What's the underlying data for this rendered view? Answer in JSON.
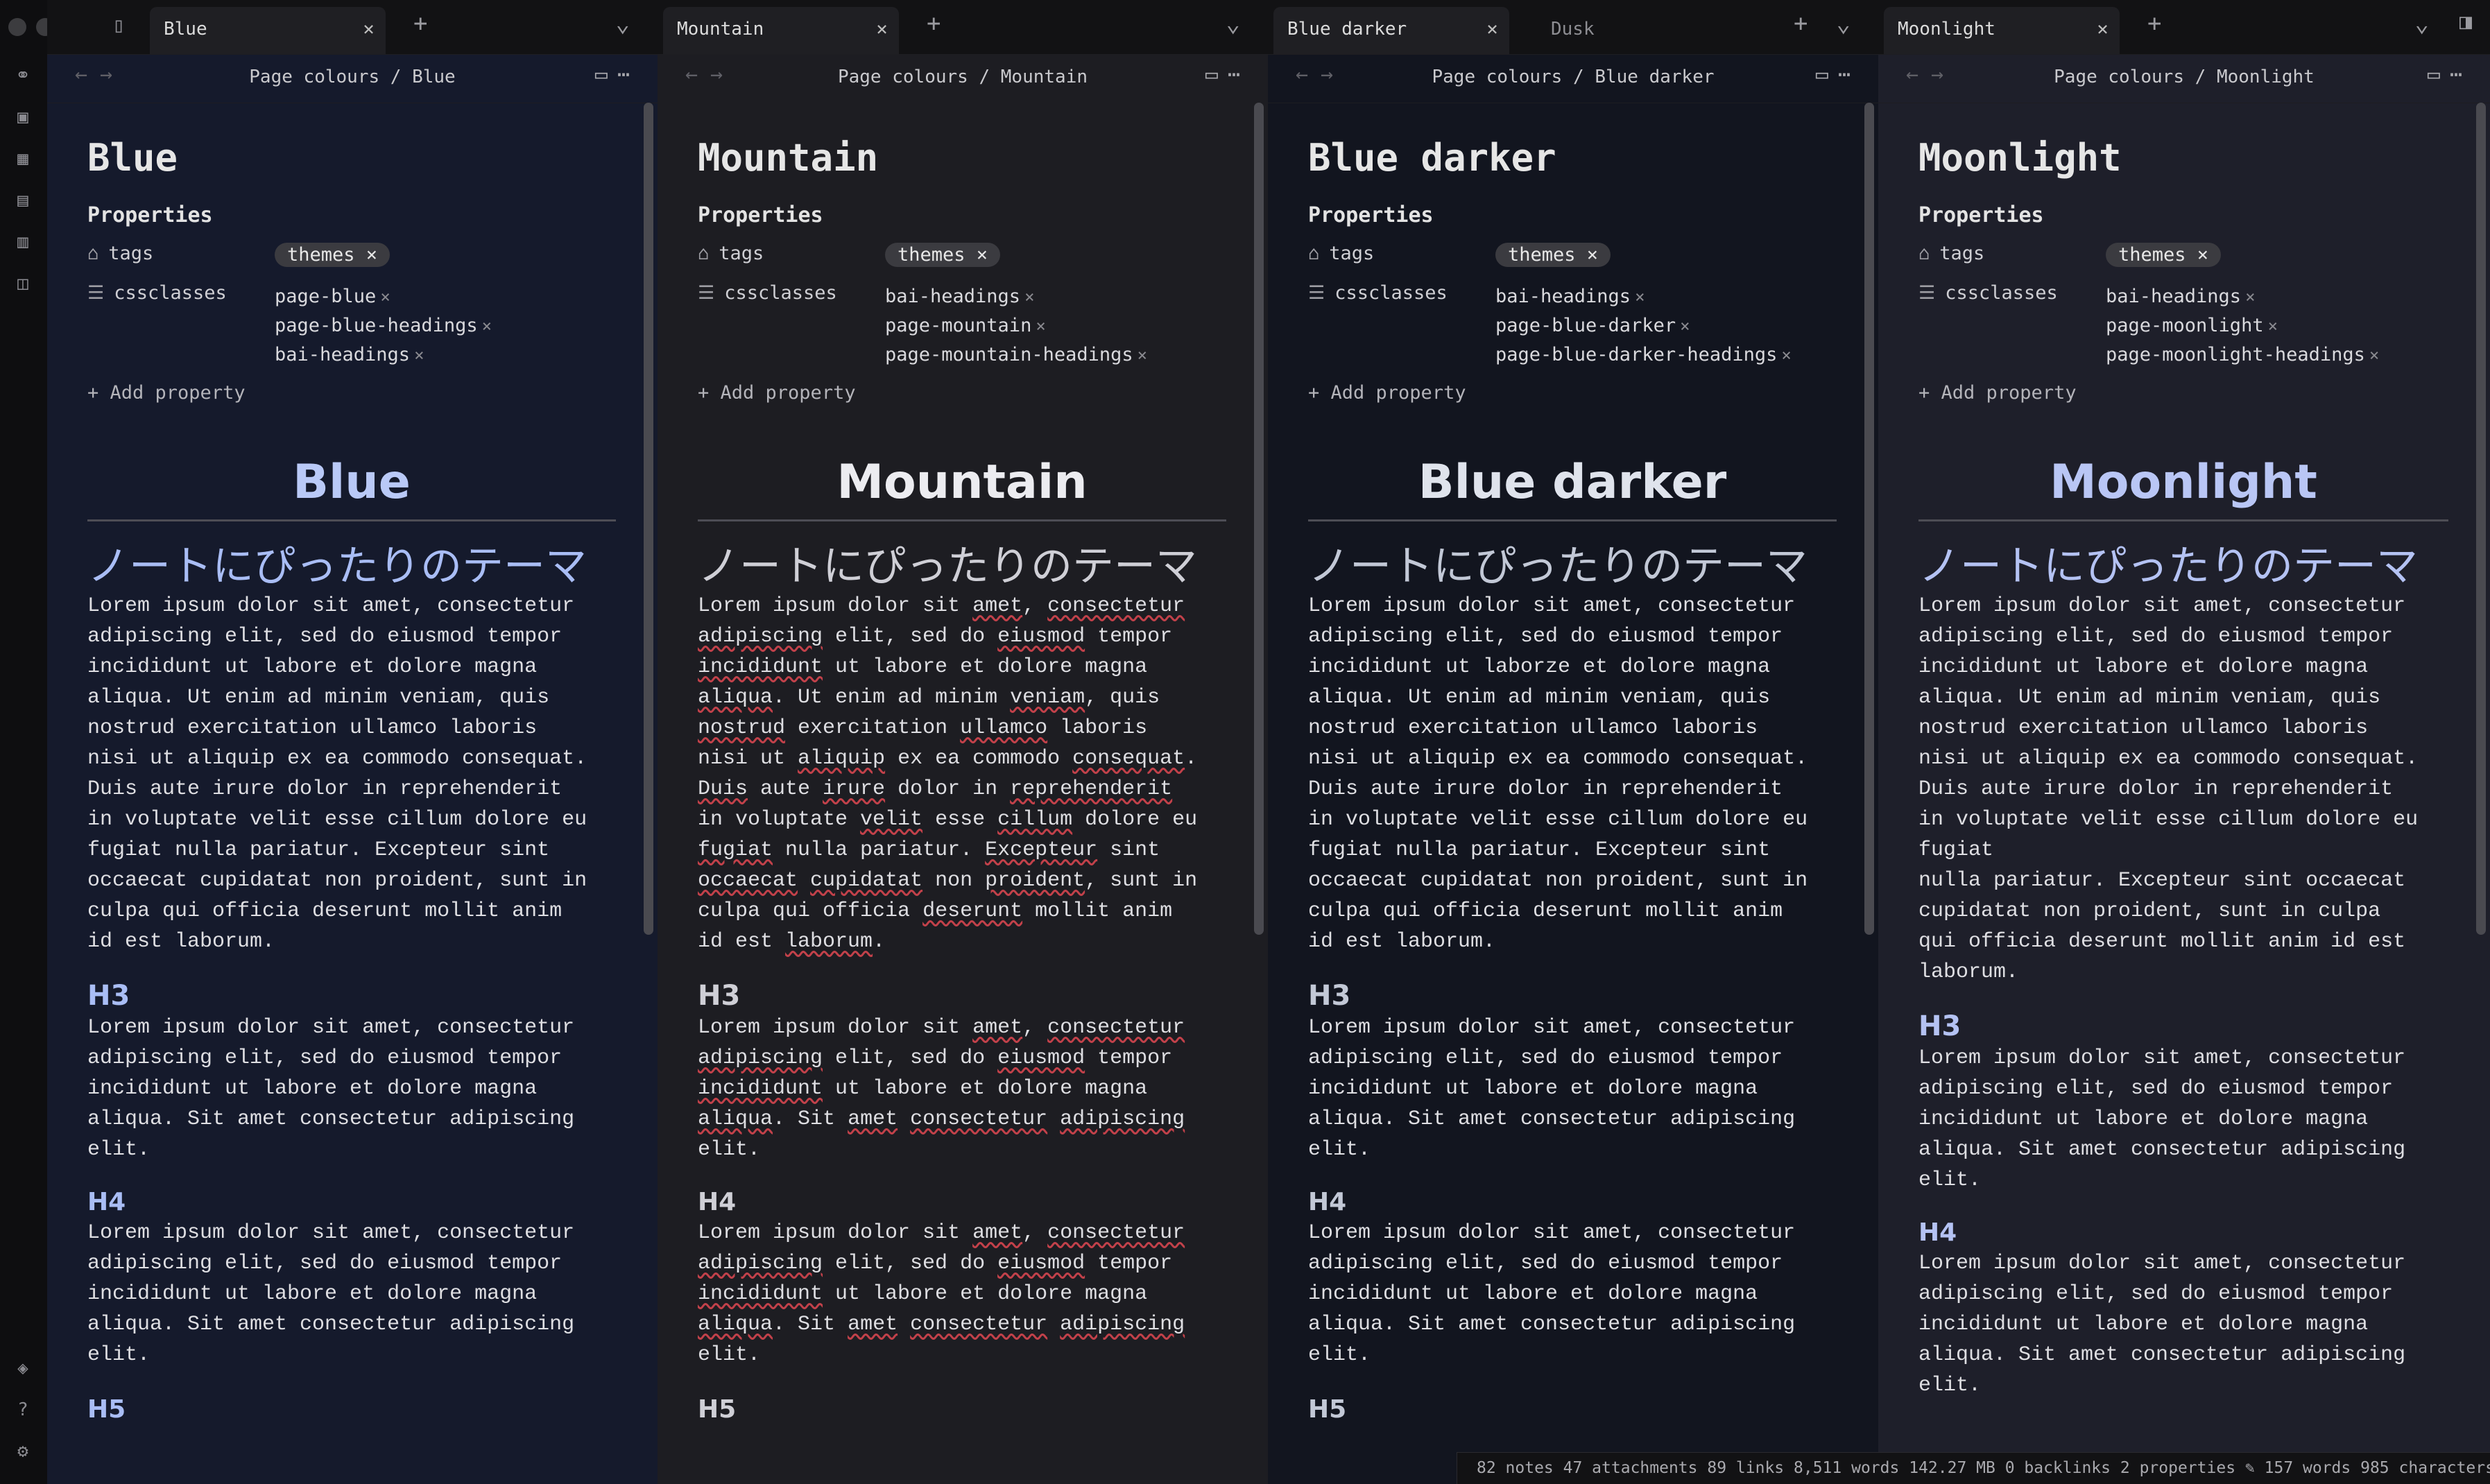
{
  "statusbar": {
    "notes": "82 notes",
    "attachments": "47 attachments",
    "links": "89 links",
    "words": "8,511 words",
    "size": "142.27 MB",
    "backlinks": "0 backlinks",
    "properties": "2 properties",
    "note_words": "157 words",
    "chars": "985 characters"
  },
  "panes": [
    {
      "tabs": [
        "Blue"
      ],
      "crumb_parent": "Page colours",
      "crumb_note": "Blue",
      "title": "Blue",
      "properties_label": "Properties",
      "tags_key": "tags",
      "tag": "themes",
      "cssclasses_key": "cssclasses",
      "cssclasses": [
        "page-blue",
        "page-blue-headings",
        "bai-headings"
      ],
      "add_property": "Add property",
      "h1": "Blue",
      "jp_heading": "ノートにぴったりのテーマ",
      "para1": "Lorem ipsum dolor sit amet, consectetur\nadipiscing elit, sed do eiusmod tempor\nincididunt ut labore et dolore magna\naliqua. Ut enim ad minim veniam, quis\nnostrud exercitation ullamco laboris\nnisi ut aliquip ex ea commodo consequat.\nDuis aute irure dolor in reprehenderit\nin voluptate velit esse cillum dolore eu\nfugiat nulla pariatur. Excepteur sint\noccaecat cupidatat non proident, sunt in\nculpa qui officia deserunt mollit anim\nid est laborum.",
      "h3": "H3",
      "para2": "Lorem ipsum dolor sit amet, consectetur\nadipiscing elit, sed do eiusmod tempor\nincididunt ut labore et dolore magna\naliqua. Sit amet consectetur adipiscing\nelit.",
      "h4": "H4",
      "para3": "Lorem ipsum dolor sit amet, consectetur\nadipiscing elit, sed do eiusmod tempor\nincididunt ut labore et dolore magna\naliqua. Sit amet consectetur adipiscing\nelit.",
      "h5": "H5",
      "colors": {
        "bg": "#151a2c",
        "heading": "#a9bdf5",
        "h1": "#b9c9f7"
      }
    },
    {
      "tabs": [
        "Mountain"
      ],
      "crumb_parent": "Page colours",
      "crumb_note": "Mountain",
      "title": "Mountain",
      "properties_label": "Properties",
      "tags_key": "tags",
      "tag": "themes",
      "cssclasses_key": "cssclasses",
      "cssclasses": [
        "bai-headings",
        "page-mountain",
        "page-mountain-headings"
      ],
      "add_property": "Add property",
      "h1": "Mountain",
      "jp_heading": "ノートにぴったりのテーマ",
      "para1": "Lorem ipsum dolor sit amet, consectetur\nadipiscing elit, sed do eiusmod tempor\nincididunt ut labore et dolore magna\naliqua. Ut enim ad minim veniam, quis\nnostrud exercitation ullamco laboris\nnisi ut aliquip ex ea commodo consequat.\nDuis aute irure dolor in reprehenderit\nin voluptate velit esse cillum dolore eu\nfugiat nulla pariatur. Excepteur sint\noccaecat cupidatat non proident, sunt in\nculpa qui officia deserunt mollit anim\nid est laborum.",
      "h3": "H3",
      "para2": "Lorem ipsum dolor sit amet, consectetur\nadipiscing elit, sed do eiusmod tempor\nincididunt ut labore et dolore magna\naliqua. Sit amet consectetur adipiscing\nelit.",
      "h4": "H4",
      "para3": "Lorem ipsum dolor sit amet, consectetur\nadipiscing elit, sed do eiusmod tempor\nincididunt ut labore et dolore magna\naliqua. Sit amet consectetur adipiscing\nelit.",
      "h5": "H5",
      "colors": {
        "bg": "#1d1d22",
        "heading": "#cfcfd6",
        "h1": "#ececf0"
      }
    },
    {
      "tabs": [
        "Blue darker",
        "Dusk"
      ],
      "crumb_parent": "Page colours",
      "crumb_note": "Blue darker",
      "title": "Blue darker",
      "properties_label": "Properties",
      "tags_key": "tags",
      "tag": "themes",
      "cssclasses_key": "cssclasses",
      "cssclasses": [
        "bai-headings",
        "page-blue-darker",
        "page-blue-darker-headings"
      ],
      "add_property": "Add property",
      "h1": "Blue darker",
      "jp_heading": "ノートにぴったりのテーマ",
      "para1": "Lorem ipsum dolor sit amet, consectetur\nadipiscing elit, sed do eiusmod tempor\nincididunt ut laborze et dolore magna\naliqua. Ut enim ad minim veniam, quis\nnostrud exercitation ullamco laboris\nnisi ut aliquip ex ea commodo consequat.\nDuis aute irure dolor in reprehenderit\nin voluptate velit esse cillum dolore eu\nfugiat nulla pariatur. Excepteur sint\noccaecat cupidatat non proident, sunt in\nculpa qui officia deserunt mollit anim\nid est laborum.",
      "h3": "H3",
      "para2": "Lorem ipsum dolor sit amet, consectetur\nadipiscing elit, sed do eiusmod tempor\nincididunt ut labore et dolore magna\naliqua. Sit amet consectetur adipiscing\nelit.",
      "h4": "H4",
      "para3": "Lorem ipsum dolor sit amet, consectetur\nadipiscing elit, sed do eiusmod tempor\nincididunt ut labore et dolore magna\naliqua. Sit amet consectetur adipiscing\nelit.",
      "h5": "H5",
      "colors": {
        "bg": "#12151f",
        "heading": "#c2c8d6",
        "h1": "#dfe3ec"
      }
    },
    {
      "tabs": [
        "Moonlight"
      ],
      "crumb_parent": "Page colours",
      "crumb_note": "Moonlight",
      "title": "Moonlight",
      "properties_label": "Properties",
      "tags_key": "tags",
      "tag": "themes",
      "cssclasses_key": "cssclasses",
      "cssclasses": [
        "bai-headings",
        "page-moonlight",
        "page-moonlight-headings"
      ],
      "add_property": "Add property",
      "h1": "Moonlight",
      "jp_heading": "ノートにぴったりのテーマ",
      "para1": "Lorem ipsum dolor sit amet, consectetur\nadipiscing elit, sed do eiusmod tempor\nincididunt ut labore et dolore magna\naliqua. Ut enim ad minim veniam, quis\nnostrud exercitation ullamco laboris\nnisi ut aliquip ex ea commodo consequat.\nDuis aute irure dolor in reprehenderit\nin voluptate velit esse cillum dolore eu\nfugiat\nnulla pariatur. Excepteur sint occaecat\ncupidatat non proident, sunt in culpa\nqui officia deserunt mollit anim id est\nlaborum.",
      "h3": "H3",
      "para2": "Lorem ipsum dolor sit amet, consectetur\nadipiscing elit, sed do eiusmod tempor\nincididunt ut labore et dolore magna\naliqua. Sit amet consectetur adipiscing\nelit.",
      "h4": "H4",
      "para3": "Lorem ipsum dolor sit amet, consectetur\nadipiscing elit, sed do eiusmod tempor\nincididunt ut labore et dolore magna\naliqua. Sit amet consectetur adipiscing\nelit.",
      "h5": "",
      "colors": {
        "bg": "#1e1f2a",
        "heading": "#b4c2f3",
        "h1": "#b9c6f5"
      }
    }
  ]
}
